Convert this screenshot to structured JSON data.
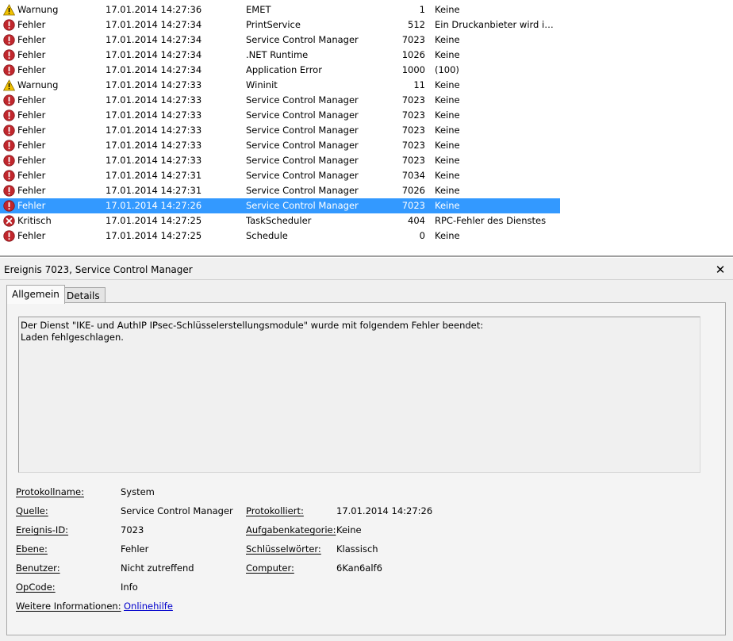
{
  "events": [
    {
      "level": "Warnung",
      "icon": "warning-icon",
      "date": "17.01.2014 14:27:36",
      "source": "EMET",
      "id": "1",
      "task": "Keine"
    },
    {
      "level": "Fehler",
      "icon": "error-icon",
      "date": "17.01.2014 14:27:34",
      "source": "PrintService",
      "id": "512",
      "task": "Ein Druckanbieter wird initi…"
    },
    {
      "level": "Fehler",
      "icon": "error-icon",
      "date": "17.01.2014 14:27:34",
      "source": "Service Control Manager",
      "id": "7023",
      "task": "Keine"
    },
    {
      "level": "Fehler",
      "icon": "error-icon",
      "date": "17.01.2014 14:27:34",
      "source": ".NET Runtime",
      "id": "1026",
      "task": "Keine"
    },
    {
      "level": "Fehler",
      "icon": "error-icon",
      "date": "17.01.2014 14:27:34",
      "source": "Application Error",
      "id": "1000",
      "task": "(100)"
    },
    {
      "level": "Warnung",
      "icon": "warning-icon",
      "date": "17.01.2014 14:27:33",
      "source": "Wininit",
      "id": "11",
      "task": "Keine"
    },
    {
      "level": "Fehler",
      "icon": "error-icon",
      "date": "17.01.2014 14:27:33",
      "source": "Service Control Manager",
      "id": "7023",
      "task": "Keine"
    },
    {
      "level": "Fehler",
      "icon": "error-icon",
      "date": "17.01.2014 14:27:33",
      "source": "Service Control Manager",
      "id": "7023",
      "task": "Keine"
    },
    {
      "level": "Fehler",
      "icon": "error-icon",
      "date": "17.01.2014 14:27:33",
      "source": "Service Control Manager",
      "id": "7023",
      "task": "Keine"
    },
    {
      "level": "Fehler",
      "icon": "error-icon",
      "date": "17.01.2014 14:27:33",
      "source": "Service Control Manager",
      "id": "7023",
      "task": "Keine"
    },
    {
      "level": "Fehler",
      "icon": "error-icon",
      "date": "17.01.2014 14:27:33",
      "source": "Service Control Manager",
      "id": "7023",
      "task": "Keine"
    },
    {
      "level": "Fehler",
      "icon": "error-icon",
      "date": "17.01.2014 14:27:31",
      "source": "Service Control Manager",
      "id": "7034",
      "task": "Keine"
    },
    {
      "level": "Fehler",
      "icon": "error-icon",
      "date": "17.01.2014 14:27:31",
      "source": "Service Control Manager",
      "id": "7026",
      "task": "Keine"
    },
    {
      "level": "Fehler",
      "icon": "error-icon",
      "date": "17.01.2014 14:27:26",
      "source": "Service Control Manager",
      "id": "7023",
      "task": "Keine",
      "selected": true
    },
    {
      "level": "Kritisch",
      "icon": "critical-icon",
      "date": "17.01.2014 14:27:25",
      "source": "TaskScheduler",
      "id": "404",
      "task": "RPC-Fehler des Dienstes"
    },
    {
      "level": "Fehler",
      "icon": "error-icon",
      "date": "17.01.2014 14:27:25",
      "source": "Schedule",
      "id": "0",
      "task": "Keine"
    }
  ],
  "detail": {
    "title": "Ereignis 7023, Service Control Manager",
    "close_glyph": "✕",
    "tabs": {
      "general": "Allgemein",
      "details": "Details"
    },
    "message": {
      "line1": "Der Dienst \"IKE- und AuthIP IPsec-Schlüsselerstellungsmodule\" wurde mit folgendem Fehler beendet:",
      "line2": "Laden fehlgeschlagen."
    },
    "labels": {
      "log_name": "Protokollname:",
      "source": "Quelle:",
      "event_id": "Ereignis-ID:",
      "level": "Ebene:",
      "user": "Benutzer:",
      "opcode": "OpCode:",
      "more_info": "Weitere Informationen:",
      "logged": "Protokolliert:",
      "task_category": "Aufgabenkategorie:",
      "keywords": "Schlüsselwörter:",
      "computer": "Computer:"
    },
    "values": {
      "log_name": "System",
      "source": "Service Control Manager",
      "event_id": "7023",
      "level": "Fehler",
      "user": "Nicht zutreffend",
      "opcode": "Info",
      "more_info_link": "Onlinehilfe",
      "logged": "17.01.2014 14:27:26",
      "task_category": "Keine",
      "keywords": "Klassisch",
      "computer": "6Kan6alf6"
    }
  },
  "colors": {
    "selection": "#3399ff",
    "error": "#c0272d",
    "warning": "#f2c200",
    "link": "#0000cc"
  }
}
